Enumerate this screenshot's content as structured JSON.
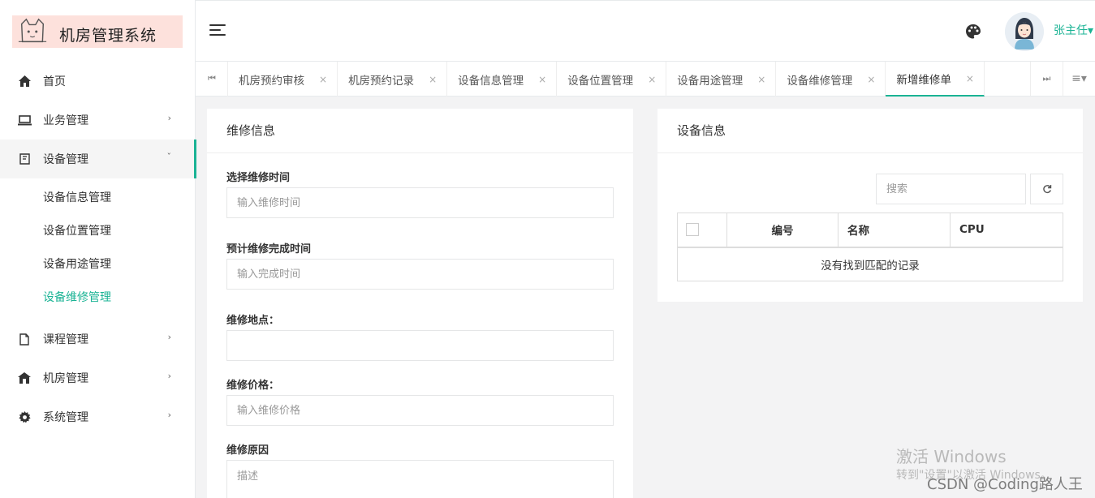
{
  "app": {
    "logo_title": "机房管理系统"
  },
  "sidebar": {
    "items": [
      {
        "label": "首页",
        "icon": "home-icon"
      },
      {
        "label": "业务管理",
        "icon": "laptop-icon"
      },
      {
        "label": "设备管理",
        "icon": "device-icon"
      },
      {
        "label": "课程管理",
        "icon": "file-icon"
      },
      {
        "label": "机房管理",
        "icon": "building-icon"
      },
      {
        "label": "系统管理",
        "icon": "gear-icon"
      }
    ],
    "sub_items": [
      "设备信息管理",
      "设备位置管理",
      "设备用途管理",
      "设备维修管理"
    ],
    "active_sub": "设备维修管理"
  },
  "header": {
    "user_name": "张主任▾"
  },
  "tabs": [
    {
      "label": "机房预约审核",
      "active": false
    },
    {
      "label": "机房预约记录",
      "active": false
    },
    {
      "label": "设备信息管理",
      "active": false
    },
    {
      "label": "设备位置管理",
      "active": false
    },
    {
      "label": "设备用途管理",
      "active": false
    },
    {
      "label": "设备维修管理",
      "active": false
    },
    {
      "label": "新增维修单",
      "active": true
    }
  ],
  "tab_close_glyph": "×",
  "repair_form": {
    "title": "维修信息",
    "fields": [
      {
        "label": "选择维修时间",
        "placeholder": "输入维修时间",
        "value": ""
      },
      {
        "label": "预计维修完成时间",
        "placeholder": "输入完成时间",
        "value": ""
      },
      {
        "label": "维修地点：",
        "placeholder": "",
        "value": ""
      },
      {
        "label": "维修价格：",
        "placeholder": "输入维修价格",
        "value": ""
      },
      {
        "label": "维修原因",
        "placeholder": "描述",
        "value": ""
      }
    ]
  },
  "device_panel": {
    "title": "设备信息",
    "search_placeholder": "搜索",
    "columns": [
      "编号",
      "名称",
      "CPU"
    ],
    "empty_text": "没有找到匹配的记录"
  },
  "watermark": {
    "line1": "激活 Windows",
    "line2": "转到\"设置\"以激活 Windows。",
    "credit": "CSDN @Coding路人王"
  },
  "colors": {
    "accent": "#1ab394",
    "logo_bg": "#fde1dc"
  }
}
